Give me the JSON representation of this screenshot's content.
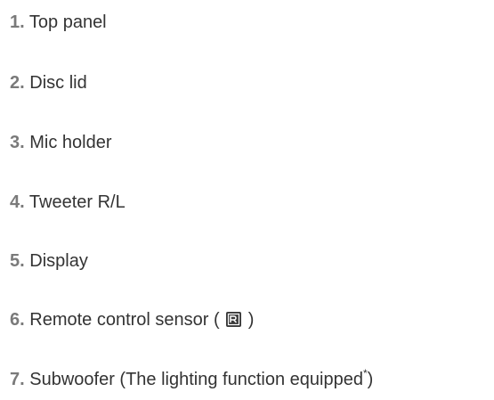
{
  "parts": [
    {
      "number": "1.",
      "label": "Top panel"
    },
    {
      "number": "2.",
      "label": "Disc lid"
    },
    {
      "number": "3.",
      "label": "Mic holder"
    },
    {
      "number": "4.",
      "label": "Tweeter R/L"
    },
    {
      "number": "5.",
      "label": "Display"
    },
    {
      "number": "6.",
      "label_before": "Remote control sensor (",
      "icon": "remote-sensor-icon",
      "label_after": ")"
    },
    {
      "number": "7.",
      "label": "Subwoofer (The lighting function equipped",
      "footnote": "*",
      "label_after": ")"
    }
  ],
  "colors": {
    "number": "#7a7a7a",
    "text": "#333333",
    "icon_bg": "#3a3a3a"
  }
}
